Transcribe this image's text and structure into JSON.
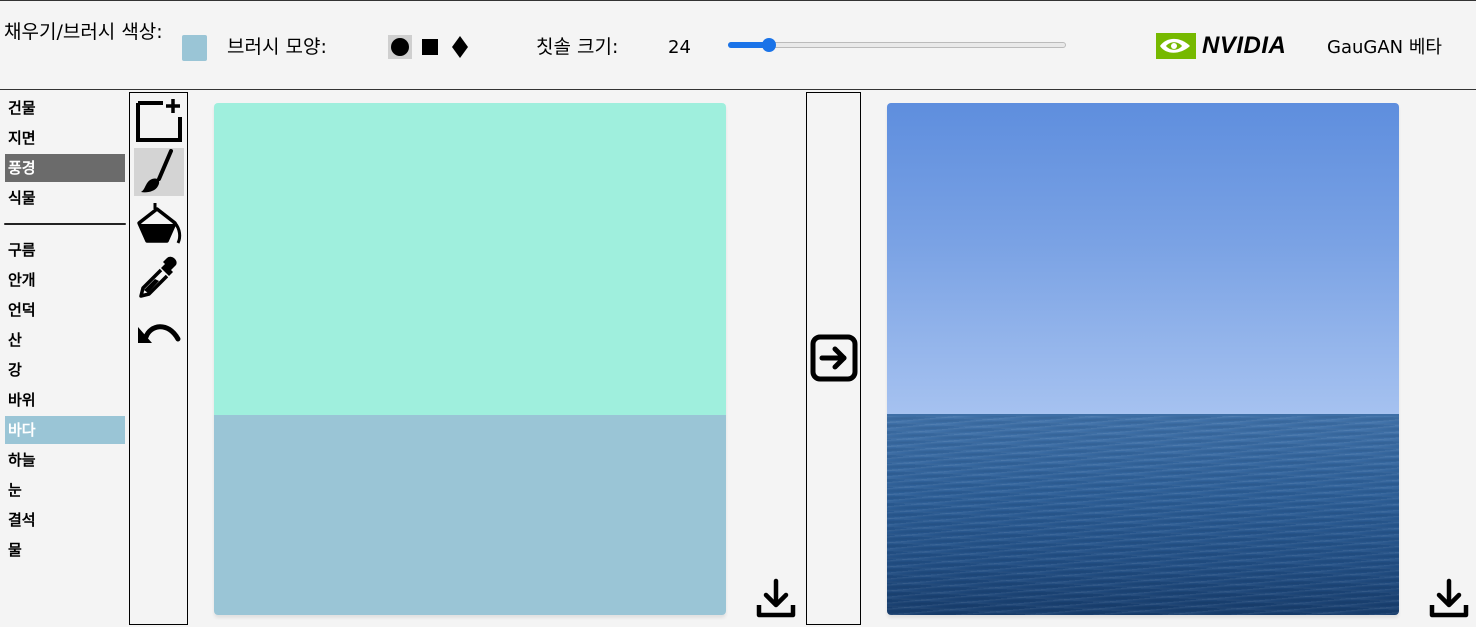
{
  "toolbar": {
    "fill_brush_color_label": "채우기/브러시 색상:",
    "brush_color": "#9ac5d6",
    "brush_shape_label": "브러시 모양:",
    "brush_shapes": [
      {
        "icon": "circle-icon",
        "active": true
      },
      {
        "icon": "square-icon",
        "active": false
      },
      {
        "icon": "diamond-icon",
        "active": false
      }
    ],
    "brush_size_label": "칫솔 크기:",
    "brush_size_value": "24",
    "brush_size_slider_fraction": 0.12,
    "brand_name": "NVIDIA",
    "brand_color": "#76b900",
    "app_name": "GauGAN 베타"
  },
  "labels": {
    "group1": [
      "건물",
      "지면",
      "풍경",
      "식물"
    ],
    "group2": [
      "구름",
      "안개",
      "언덕",
      "산",
      "강",
      "바위",
      "바다",
      "하늘",
      "눈",
      "결석",
      "물"
    ],
    "active_category": "풍경",
    "active_label": "바다",
    "active_category_color": "#6b6b6b",
    "active_label_color": "#9ac5d6"
  },
  "tools": [
    {
      "icon": "new-canvas-icon",
      "active": false
    },
    {
      "icon": "brush-icon",
      "active": true
    },
    {
      "icon": "paint-bucket-icon",
      "active": false
    },
    {
      "icon": "eyedropper-icon",
      "active": false
    },
    {
      "icon": "undo-icon",
      "active": false
    }
  ],
  "canvas": {
    "regions": [
      {
        "label": "하늘",
        "color": "#9fefdd"
      },
      {
        "label": "바다",
        "color": "#9ac5d6"
      }
    ]
  },
  "generate": {
    "icon": "arrow-right-icon"
  },
  "output": {
    "description_colors": {
      "sky": "#6f9ae2",
      "sea": "#2d5f98"
    }
  },
  "downloads": {
    "icon": "download-icon"
  }
}
